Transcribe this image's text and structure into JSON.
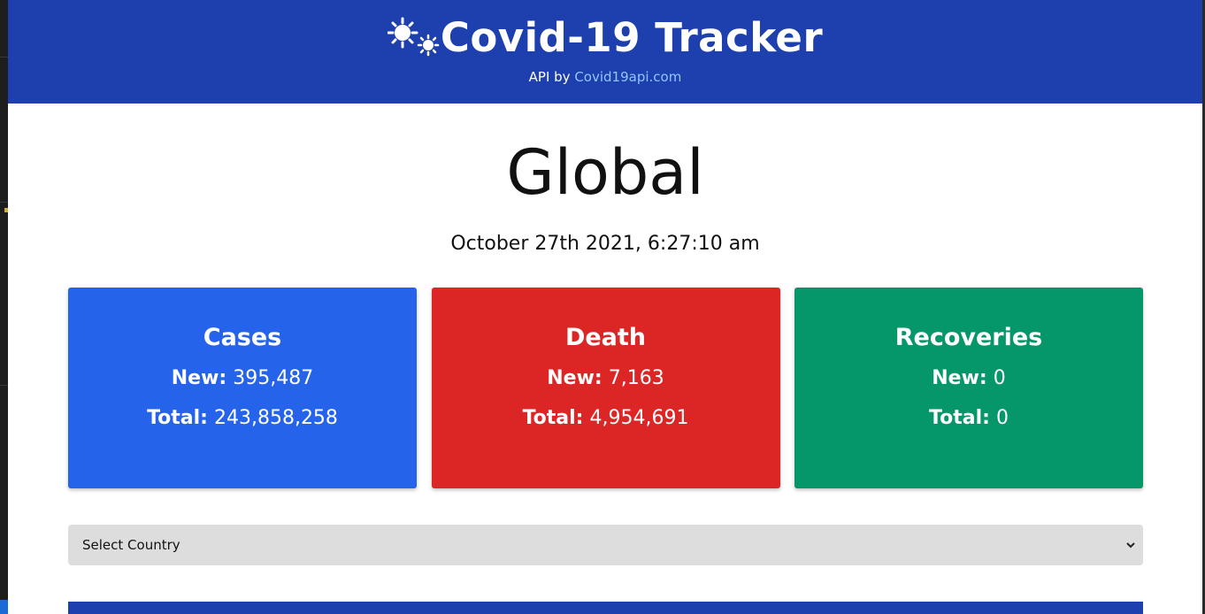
{
  "header": {
    "title": "Covid-19 Tracker",
    "api_prefix": "API by ",
    "api_link": "Covid19api.com",
    "icon": "virus-icon"
  },
  "main": {
    "heading": "Global",
    "date": "October 27th 2021, 6:27:10 am"
  },
  "cards": [
    {
      "title": "Cases",
      "new_label": "New:",
      "new_value": "395,487",
      "total_label": "Total:",
      "total_value": "243,858,258",
      "color": "#2563eb"
    },
    {
      "title": "Death",
      "new_label": "New:",
      "new_value": "7,163",
      "total_label": "Total:",
      "total_value": "4,954,691",
      "color": "#dc2626"
    },
    {
      "title": "Recoveries",
      "new_label": "New:",
      "new_value": "0",
      "total_label": "Total:",
      "total_value": "0",
      "color": "#059669"
    }
  ],
  "country_select": {
    "selected": "Select Country"
  },
  "colors": {
    "header_bg": "#1e40af",
    "link": "#93c5fd"
  }
}
